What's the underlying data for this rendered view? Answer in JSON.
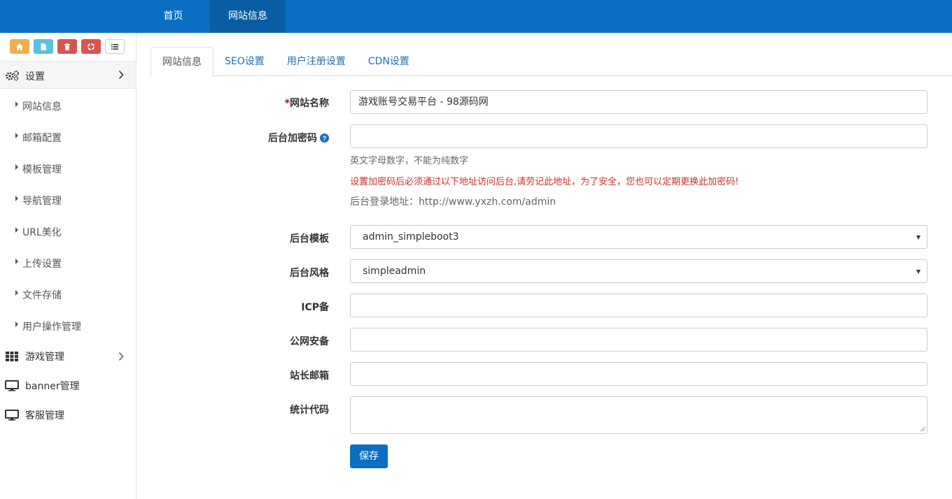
{
  "topnav": {
    "items": [
      {
        "label": "首页",
        "active": false
      },
      {
        "label": "网站信息",
        "active": true
      }
    ]
  },
  "sidebar": {
    "shortcuts": [
      {
        "icon": "home-icon",
        "color": "#f0ad4e"
      },
      {
        "icon": "file-icon",
        "color": "#5bc0de"
      },
      {
        "icon": "trash-icon",
        "color": "#d9534f"
      },
      {
        "icon": "recycle-icon",
        "color": "#d9534f"
      },
      {
        "icon": "list-icon",
        "color": "#ffffff"
      }
    ],
    "settings": {
      "label": "设置",
      "icon": "gears-icon",
      "items": [
        {
          "label": "网站信息"
        },
        {
          "label": "邮箱配置"
        },
        {
          "label": "模板管理"
        },
        {
          "label": "导航管理"
        },
        {
          "label": "URL美化"
        },
        {
          "label": "上传设置"
        },
        {
          "label": "文件存储"
        },
        {
          "label": "用户操作管理"
        }
      ]
    },
    "menu": [
      {
        "label": "游戏管理",
        "icon": "grid-icon",
        "has_arrow": true
      },
      {
        "label": "banner管理",
        "icon": "monitor-icon",
        "has_arrow": false
      },
      {
        "label": "客服管理",
        "icon": "monitor-icon",
        "has_arrow": false
      }
    ]
  },
  "tabs": [
    {
      "label": "网站信息",
      "active": true
    },
    {
      "label": "SEO设置",
      "active": false
    },
    {
      "label": "用户注册设置",
      "active": false
    },
    {
      "label": "CDN设置",
      "active": false
    }
  ],
  "form": {
    "site_name": {
      "required_mark": "*",
      "label": "网站名称",
      "value": "游戏账号交易平台 - 98源码网"
    },
    "admin_password": {
      "label": "后台加密码",
      "value": "",
      "help": "英文字母数字，不能为纯数字",
      "warning": "设置加密码后必须通过以下地址访问后台,请劳记此地址，为了安全，您也可以定期更换此加密码!",
      "login_url": "后台登录地址：http://www.yxzh.com/admin"
    },
    "admin_theme": {
      "label": "后台模板",
      "value": "admin_simpleboot3"
    },
    "admin_style": {
      "label": "后台风格",
      "value": "simpleadmin"
    },
    "icp": {
      "label": "ICP备",
      "value": ""
    },
    "police": {
      "label": "公网安备",
      "value": ""
    },
    "email": {
      "label": "站长邮箱",
      "value": ""
    },
    "stat_code": {
      "label": "统计代码",
      "value": ""
    },
    "save_label": "保存"
  },
  "colors": {
    "brand": "#0a6fc2",
    "brand_dark": "#095da5",
    "warning": "#c9302c",
    "link": "#1f6fb2"
  }
}
